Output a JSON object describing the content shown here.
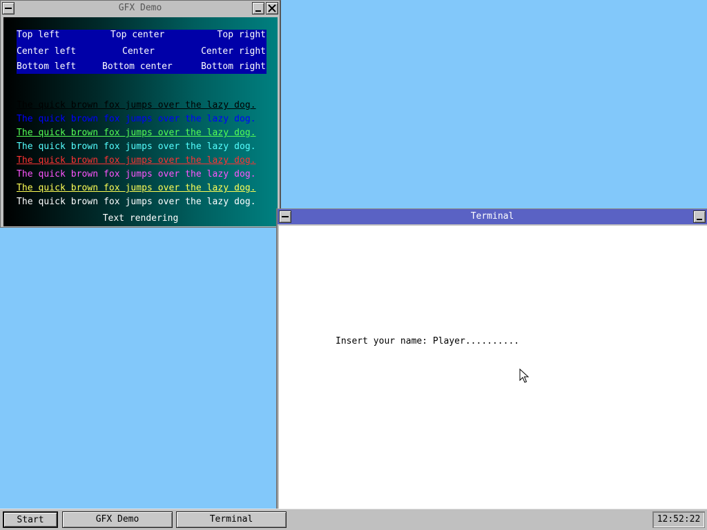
{
  "gfx_window": {
    "title": "GFX Demo",
    "alignment_labels": {
      "top_left": "Top left",
      "top_center": "Top center",
      "top_right": "Top right",
      "center_left": "Center left",
      "center": "Center",
      "center_right": "Center right",
      "bottom_left": "Bottom left",
      "bottom_center": "Bottom center",
      "bottom_right": "Bottom right"
    },
    "sample_lines": [
      {
        "text": "The quick brown fox jumps over the lazy dog.",
        "color": "#000000",
        "underline": true
      },
      {
        "text": "The quick brown fox jumps over the lazy dog.",
        "color": "#0000ff",
        "underline": false
      },
      {
        "text": "The quick brown fox jumps over the lazy dog.",
        "color": "#55ff55",
        "underline": true
      },
      {
        "text": "The quick brown fox jumps over the lazy dog.",
        "color": "#55ffff",
        "underline": false
      },
      {
        "text": "The quick brown fox jumps over the lazy dog.",
        "color": "#ff3333",
        "underline": true
      },
      {
        "text": "The quick brown fox jumps over the lazy dog.",
        "color": "#ff55ff",
        "underline": false
      },
      {
        "text": "The quick brown fox jumps over the lazy dog.",
        "color": "#ffff55",
        "underline": true
      },
      {
        "text": "The quick brown fox jumps over the lazy dog.",
        "color": "#ffffff",
        "underline": false
      }
    ],
    "caption": "Text rendering"
  },
  "terminal_window": {
    "title": "Terminal",
    "prompt_text": "Insert your name: Player.........."
  },
  "taskbar": {
    "start_label": "Start",
    "tasks": [
      "GFX Demo",
      "Terminal"
    ],
    "clock": "12:52:22"
  },
  "colors": {
    "desktop": "#82c8fa",
    "terminal_titlebar": "#5a62c4",
    "alignment_box": "#0000a8"
  }
}
